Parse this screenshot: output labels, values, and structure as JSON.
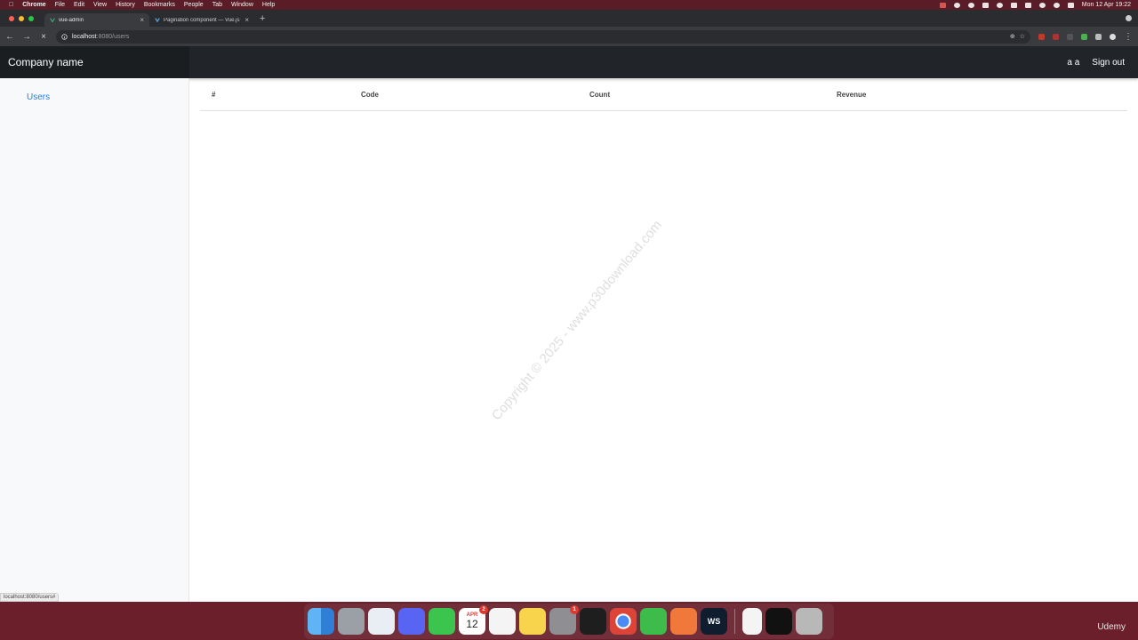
{
  "menubar": {
    "app": "Chrome",
    "items": [
      "File",
      "Edit",
      "View",
      "History",
      "Bookmarks",
      "People",
      "Tab",
      "Window",
      "Help"
    ],
    "clock": "Mon 12 Apr 19:22"
  },
  "browser": {
    "tabs": [
      {
        "title": "vue-admin",
        "active": true
      },
      {
        "title": "Pagination component — Vue.js",
        "active": false
      }
    ],
    "url_host": "localhost",
    "url_rest": ":8080/users"
  },
  "app": {
    "brand": "Company name",
    "user": "a a",
    "signout": "Sign out",
    "sidebar": {
      "items": [
        {
          "label": "Users"
        }
      ]
    },
    "table": {
      "headers": [
        "#",
        "Code",
        "Count",
        "Revenue"
      ]
    }
  },
  "watermark": "Copyright © 2025 - www.p30download.com",
  "status_url": "localhost:8080/users#",
  "dock": {
    "calendar": {
      "month": "APR",
      "day": "12"
    },
    "badges": {
      "calendar": "2",
      "settings": "1"
    },
    "webstorm": "WS"
  },
  "udemy": "Udemy",
  "colors": {
    "navbar": "#212529",
    "brand_bg": "#1b1e21",
    "sidebar": "#f8f9fa",
    "link": "#2b7bd9"
  }
}
